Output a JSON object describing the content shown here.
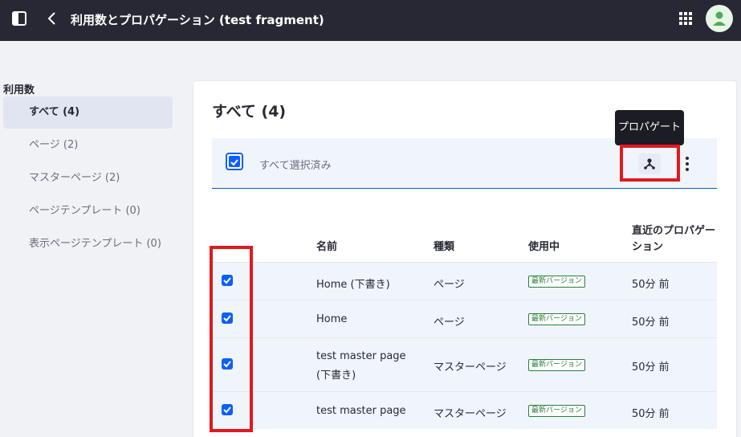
{
  "header": {
    "title": "利用数とプロパゲーション (test fragment)",
    "sidebar_toggle_icon": "sidebar-toggle-icon",
    "back_icon": "chevron-left-icon",
    "apps_icon": "apps-grid-icon",
    "avatar_icon": "user-avatar-icon"
  },
  "sidebar": {
    "heading": "利用数",
    "items": [
      {
        "label": "すべて (4)",
        "active": true
      },
      {
        "label": "ページ (2)",
        "active": false
      },
      {
        "label": "マスターページ (2)",
        "active": false
      },
      {
        "label": "ページテンプレート (0)",
        "active": false
      },
      {
        "label": "表示ページテンプレート (0)",
        "active": false
      }
    ]
  },
  "main": {
    "title": "すべて (4)",
    "management_bar": {
      "select_all_text": "すべて選択済み",
      "propagate_tooltip": "プロパゲート",
      "propagate_icon": "propagate-icon",
      "more_icon": "ellipsis-vertical-icon"
    },
    "table": {
      "columns": [
        "名前",
        "種類",
        "使用中",
        "直近のプロパゲー",
        "ション"
      ],
      "rows": [
        {
          "name": "Home (下書き)",
          "name_line2": "",
          "type": "ページ",
          "in_use": "最新バージョン",
          "last_propagation": "50分 前",
          "checked": true
        },
        {
          "name": "Home",
          "name_line2": "",
          "type": "ページ",
          "in_use": "最新バージョン",
          "last_propagation": "50分 前",
          "checked": true
        },
        {
          "name": "test master page",
          "name_line2": "(下書き)",
          "type": "マスターページ",
          "in_use": "最新バージョン",
          "last_propagation": "50分 前",
          "checked": true
        },
        {
          "name": "test master page",
          "name_line2": "",
          "type": "マスターページ",
          "in_use": "最新バージョン",
          "last_propagation": "50分 前",
          "checked": true
        }
      ]
    }
  },
  "colors": {
    "topbar": "#272833",
    "primary": "#0b5fff",
    "success": "#287d3c",
    "highlight_outline": "#e0191e"
  }
}
